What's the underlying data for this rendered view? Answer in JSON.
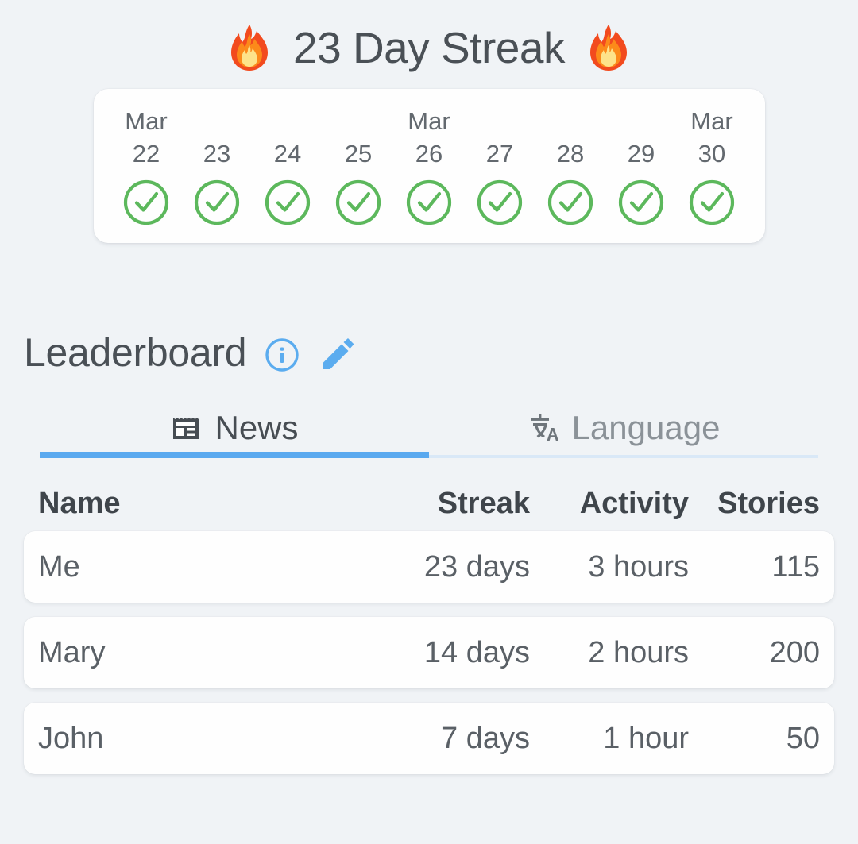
{
  "header": {
    "title": "23 Day Streak",
    "left_flame_icon": "fire-icon",
    "right_flame_icon": "fire-icon"
  },
  "calendar": {
    "days": [
      {
        "month": "Mar",
        "day": "22",
        "completed": true
      },
      {
        "month": "",
        "day": "23",
        "completed": true
      },
      {
        "month": "",
        "day": "24",
        "completed": true
      },
      {
        "month": "",
        "day": "25",
        "completed": true
      },
      {
        "month": "Mar",
        "day": "26",
        "completed": true
      },
      {
        "month": "",
        "day": "27",
        "completed": true
      },
      {
        "month": "",
        "day": "28",
        "completed": true
      },
      {
        "month": "",
        "day": "29",
        "completed": true
      },
      {
        "month": "Mar",
        "day": "30",
        "completed": true
      }
    ]
  },
  "leaderboard": {
    "title": "Leaderboard",
    "info_icon": "info-circle-icon",
    "edit_icon": "pencil-icon",
    "tabs": [
      {
        "label": "News",
        "icon": "newspaper-icon",
        "active": true
      },
      {
        "label": "Language",
        "icon": "translate-icon",
        "active": false
      }
    ],
    "columns": [
      "Name",
      "Streak",
      "Activity",
      "Stories"
    ],
    "rows": [
      {
        "name": "Me",
        "streak": "23 days",
        "activity": "3 hours",
        "stories": "115"
      },
      {
        "name": "Mary",
        "streak": "14 days",
        "activity": "2 hours",
        "stories": "200"
      },
      {
        "name": "John",
        "streak": "7 days",
        "activity": "1 hour",
        "stories": "50"
      }
    ]
  },
  "colors": {
    "background": "#f0f3f6",
    "card": "#fefefe",
    "accent_blue": "#5aa9ef",
    "check_green": "#5cb85c",
    "text_primary": "#4a5056",
    "text_muted": "#8b9298"
  }
}
